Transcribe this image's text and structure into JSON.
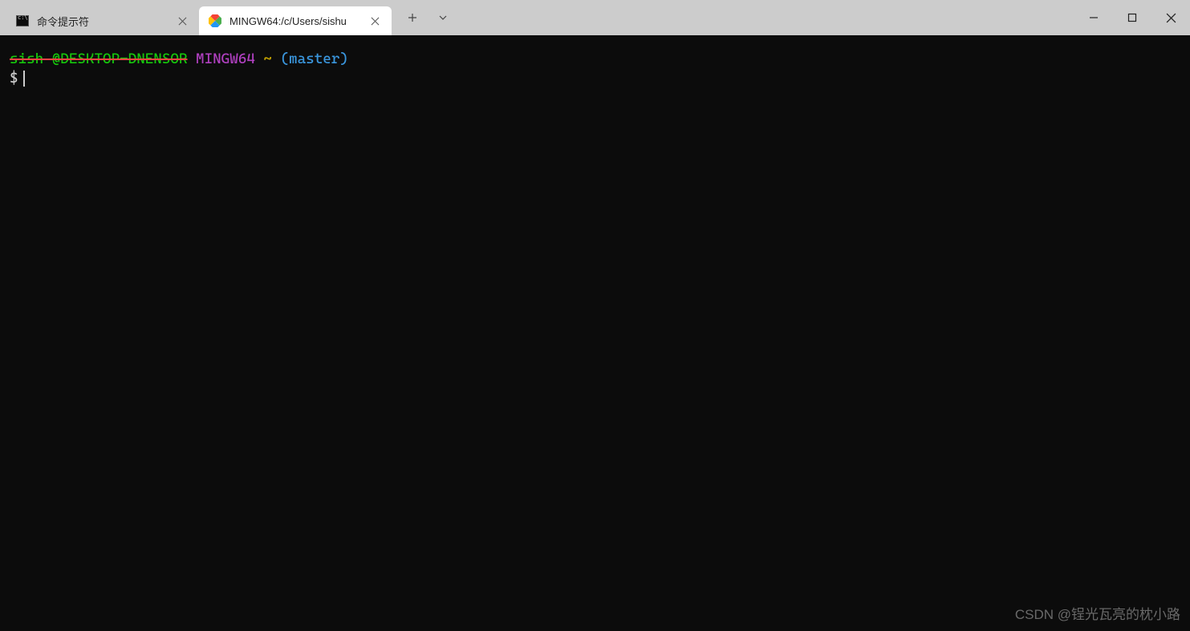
{
  "tabs": [
    {
      "title": "命令提示符",
      "active": false,
      "icon": "cmd-icon"
    },
    {
      "title": "MINGW64:/c/Users/sishu",
      "active": true,
      "icon": "git-icon"
    }
  ],
  "terminal": {
    "prompt": {
      "userhost": "sish @DESKTOP-DNENSOR",
      "mingw": "MINGW64",
      "tilde": "~",
      "branch": "(master)"
    },
    "promptSymbol": "$"
  },
  "watermark": "CSDN @锃光瓦亮的枕小路",
  "colors": {
    "terminalBg": "#0c0c0c",
    "titleBarBg": "#cccccc",
    "tabActiveBg": "#ffffff",
    "green": "#16c60c",
    "purple": "#b040c0",
    "yellow": "#c0a000",
    "cyan": "#3a96dd"
  }
}
